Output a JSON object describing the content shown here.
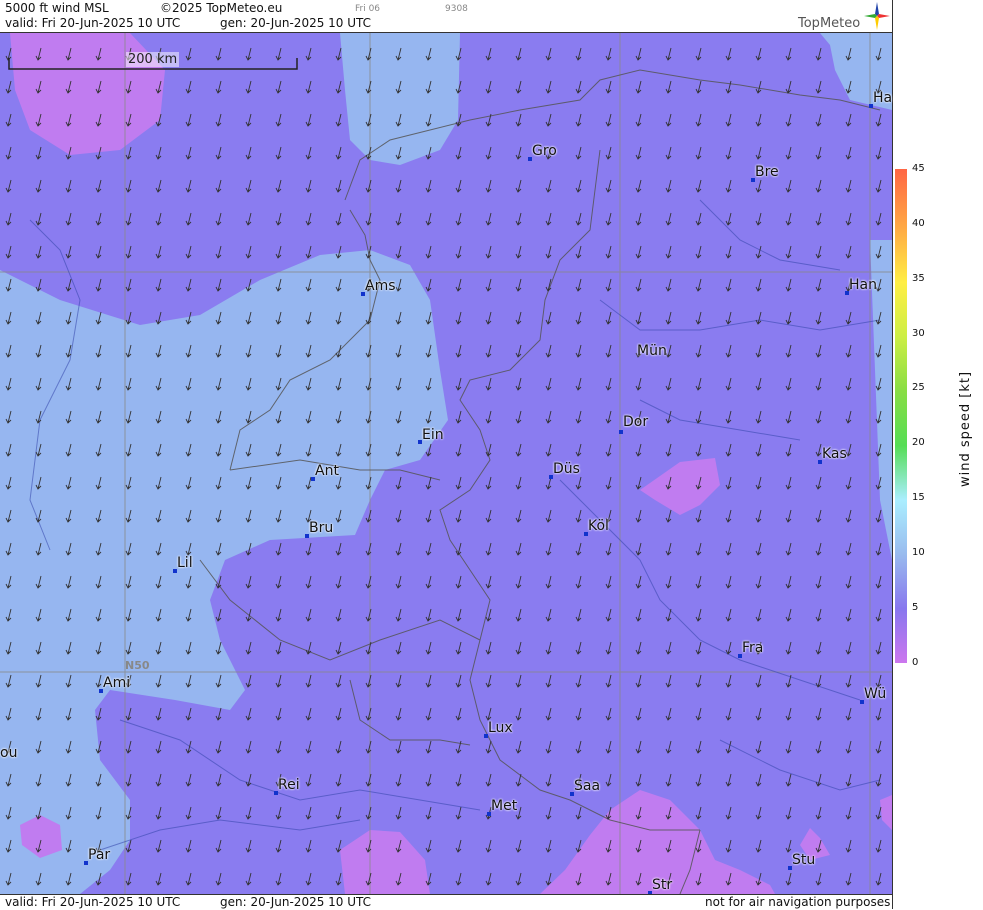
{
  "header": {
    "product": "5000 ft wind MSL",
    "copyright": "©2025 TopMeteo.eu",
    "valid": "valid:  Fri  20-Jun-2025  10 UTC",
    "gen": "gen: 20-Jun-2025 10 UTC",
    "frame_tag": "Fri 06",
    "frame_code": "9308",
    "logo": "TopMeteo"
  },
  "footer": {
    "valid": "valid:  Fri  20-Jun-2025  10 UTC",
    "gen": "gen: 20-Jun-2025 10 UTC",
    "disclaimer": "not for air navigation purposes"
  },
  "map": {
    "scale_label": "200 km",
    "gridline_label": "N50",
    "wind_direction": "north-east (arrows pointing south-west)",
    "cities": [
      {
        "name": "Ha"
      },
      {
        "name": "Gro"
      },
      {
        "name": "Bre"
      },
      {
        "name": "Ams"
      },
      {
        "name": "Han"
      },
      {
        "name": "Mün"
      },
      {
        "name": "Dor"
      },
      {
        "name": "Ein"
      },
      {
        "name": "Kas"
      },
      {
        "name": "Ant"
      },
      {
        "name": "Düs"
      },
      {
        "name": "Bru"
      },
      {
        "name": "Köl"
      },
      {
        "name": "Lil"
      },
      {
        "name": "Fra"
      },
      {
        "name": "Ami"
      },
      {
        "name": "Wü"
      },
      {
        "name": "Lux"
      },
      {
        "name": "ou"
      },
      {
        "name": "Rei"
      },
      {
        "name": "Saa"
      },
      {
        "name": "Met"
      },
      {
        "name": "Par"
      },
      {
        "name": "Stu"
      },
      {
        "name": "Str"
      }
    ]
  },
  "legend": {
    "title": "wind  speed  [kt]",
    "ticks": [
      "45",
      "40",
      "35",
      "30",
      "25",
      "20",
      "15",
      "10",
      "5",
      "0"
    ],
    "colors": {
      "0": "#cc77ee",
      "5": "#8877ee",
      "10": "#99bbee",
      "15": "#aaeeff",
      "20": "#55dd55",
      "25": "#88dd44",
      "30": "#ccee44",
      "35": "#ffee44",
      "40": "#ffaa44",
      "45": "#ff6644"
    }
  },
  "colors": {
    "low_wind_purple": "#c07cf0",
    "mid_wind_violet": "#8a7cf0",
    "light_blue": "#96b6f0"
  }
}
